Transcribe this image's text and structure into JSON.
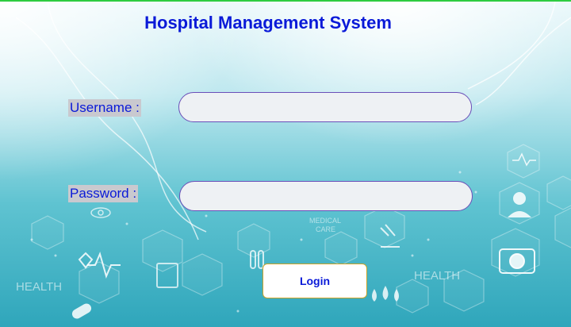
{
  "window": {
    "title": "Hospital Management System"
  },
  "form": {
    "username": {
      "label": "Username :",
      "value": "",
      "placeholder": ""
    },
    "password": {
      "label": "Password :",
      "value": "",
      "placeholder": ""
    },
    "login_label": "Login"
  },
  "background": {
    "caption_health_left": "HEALTH",
    "caption_health_right": "HEALTH",
    "caption_medical": "MEDICAL",
    "caption_care": "CARE"
  },
  "colors": {
    "title": "#0a1ad8",
    "label_bg": "#c9c9cf",
    "input_border": "#6a4fb8",
    "button_border": "#c9a227",
    "top_border": "#2ecc40"
  }
}
